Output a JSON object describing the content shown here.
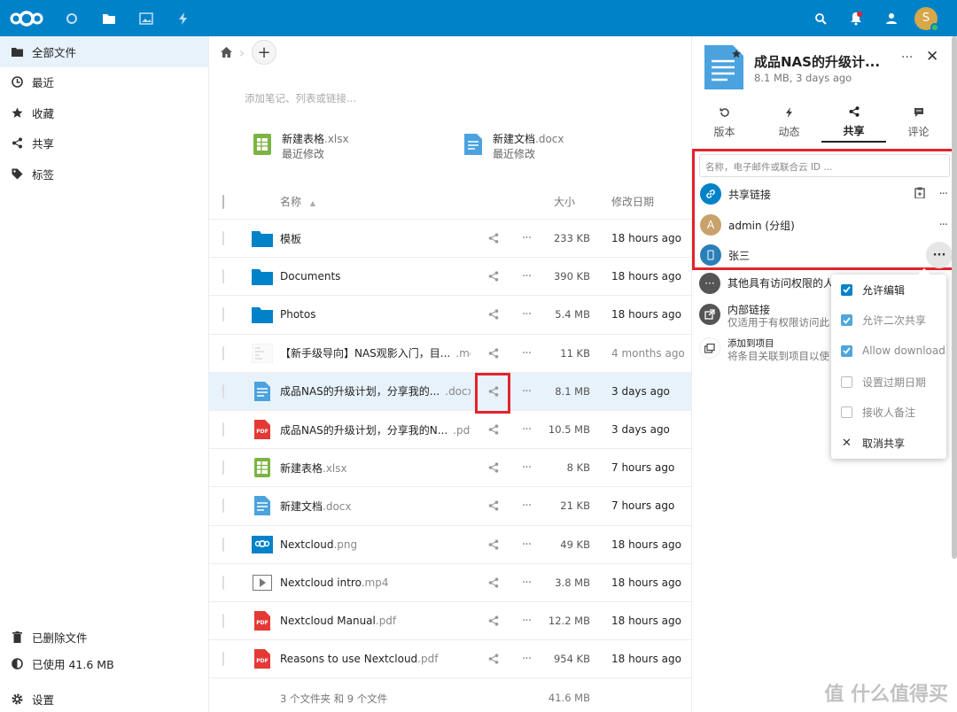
{
  "colors": {
    "brand": "#0082c9",
    "accent_red": "#e3232c",
    "folder": "#0082c9",
    "doc": "#4aa3df",
    "xlsx": "#7cb342",
    "pdf": "#e53935"
  },
  "header": {
    "apps": [
      "logo-icon",
      "dashboard-icon",
      "files-icon",
      "photos-icon",
      "activity-icon"
    ],
    "avatar_letter": "S"
  },
  "nav": {
    "items": [
      {
        "label": "全部文件",
        "icon": "folder-icon"
      },
      {
        "label": "最近",
        "icon": "clock-icon"
      },
      {
        "label": "收藏",
        "icon": "star-icon"
      },
      {
        "label": "共享",
        "icon": "share-icon"
      },
      {
        "label": "标签",
        "icon": "tag-icon"
      }
    ],
    "bottom": [
      {
        "label": "已删除文件",
        "icon": "trash-icon"
      },
      {
        "label": "已使用 41.6 MB",
        "icon": "quota-icon"
      },
      {
        "label": "设置",
        "icon": "gear-icon"
      }
    ]
  },
  "main": {
    "notes_placeholder": "添加笔记、列表或链接...",
    "recent": [
      {
        "name": "新建表格",
        "ext": ".xlsx",
        "sub": "最近修改",
        "type": "xlsx"
      },
      {
        "name": "新建文档",
        "ext": ".docx",
        "sub": "最近修改",
        "type": "doc"
      }
    ],
    "columns": {
      "name": "名称",
      "sort": "▲",
      "size": "大小",
      "modified": "修改日期"
    },
    "files": [
      {
        "name": "模板",
        "ext": "",
        "size": "233 KB",
        "modified": "18 hours ago",
        "type": "folder"
      },
      {
        "name": "Documents",
        "ext": "",
        "size": "390 KB",
        "modified": "18 hours ago",
        "type": "folder"
      },
      {
        "name": "Photos",
        "ext": "",
        "size": "5.4 MB",
        "modified": "18 hours ago",
        "type": "folder"
      },
      {
        "name": "【新手级导向】NAS观影入门，目...",
        "ext": ".md",
        "size": "11 KB",
        "modified": "4 months ago",
        "type": "md"
      },
      {
        "name": "成品NAS的升级计划，分享我的...",
        "ext": ".docx",
        "size": "8.1 MB",
        "modified": "3 days ago",
        "type": "doc"
      },
      {
        "name": "成品NAS的升级计划，分享我的N...",
        "ext": ".pdf",
        "size": "10.5 MB",
        "modified": "3 days ago",
        "type": "pdf"
      },
      {
        "name": "新建表格",
        "ext": ".xlsx",
        "size": "8 KB",
        "modified": "7 hours ago",
        "type": "xlsx"
      },
      {
        "name": "新建文档",
        "ext": ".docx",
        "size": "21 KB",
        "modified": "7 hours ago",
        "type": "doc"
      },
      {
        "name": "Nextcloud",
        "ext": ".png",
        "size": "49 KB",
        "modified": "18 hours ago",
        "type": "png"
      },
      {
        "name": "Nextcloud intro",
        "ext": ".mp4",
        "size": "3.8 MB",
        "modified": "18 hours ago",
        "type": "mp4"
      },
      {
        "name": "Nextcloud Manual",
        "ext": ".pdf",
        "size": "12.2 MB",
        "modified": "18 hours ago",
        "type": "pdf"
      },
      {
        "name": "Reasons to use Nextcloud",
        "ext": ".pdf",
        "size": "954 KB",
        "modified": "18 hours ago",
        "type": "pdf"
      }
    ],
    "summary_text": "3 个文件夹 和 9 个文件",
    "summary_size": "41.6 MB"
  },
  "sidebar": {
    "title": "成品NAS的升级计...",
    "subtitle": "8.1 MB, 3 days ago",
    "tabs": [
      {
        "label": "版本",
        "icon": "history-icon"
      },
      {
        "label": "动态",
        "icon": "activity-icon"
      },
      {
        "label": "共享",
        "icon": "share-icon"
      },
      {
        "label": "评论",
        "icon": "comment-icon"
      }
    ],
    "share_placeholder": "名称，电子邮件或联合云 ID ...",
    "share_link_label": "共享链接",
    "admin_label": "admin (分组)",
    "admin_letter": "A",
    "user_label": "张三",
    "others_label": "其他具有访问权限的人",
    "internal_label": "内部链接",
    "internal_sub": "仅适用于有权限访问此",
    "project_label": "添加到项目",
    "project_sub": "将条目关联到项目以使"
  },
  "popup": [
    {
      "label": "允许编辑",
      "checked": true,
      "dim": false
    },
    {
      "label": "允许二次共享",
      "checked": true,
      "dim": true
    },
    {
      "label": "Allow download",
      "checked": true,
      "dim": true
    },
    {
      "label": "设置过期日期",
      "checked": false,
      "dim": true
    },
    {
      "label": "接收人备注",
      "checked": false,
      "dim": true
    },
    {
      "label": "取消共享",
      "checked": null,
      "dim": false
    }
  ],
  "watermark": "值 什么值得买"
}
